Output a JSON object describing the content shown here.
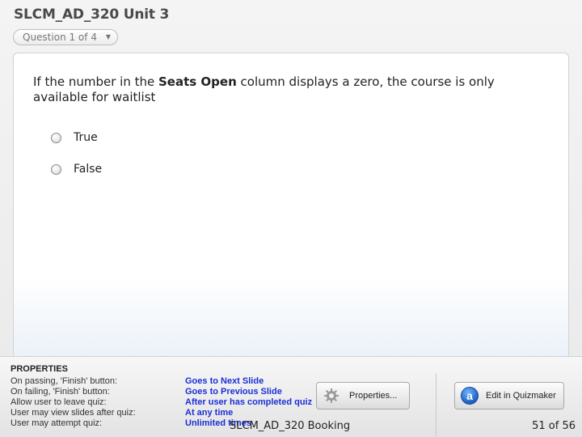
{
  "header": {
    "title": "SLCM_AD_320 Unit 3",
    "question_selector": "Question 1 of 4"
  },
  "question": {
    "text_before": "If the number in the ",
    "text_bold": "Seats Open",
    "text_after": " column displays a zero, the course is only available for waitlist",
    "choices": [
      {
        "label": "True",
        "selected": false
      },
      {
        "label": "False",
        "selected": false
      }
    ]
  },
  "properties": {
    "heading": "PROPERTIES",
    "rows": [
      {
        "label": "On passing, 'Finish' button:",
        "value": "Goes to Next Slide"
      },
      {
        "label": "On failing, 'Finish' button:",
        "value": "Goes to Previous Slide"
      },
      {
        "label": "Allow user to leave quiz:",
        "value": "After user has completed quiz"
      },
      {
        "label": "User may view slides after quiz:",
        "value": "At any time"
      },
      {
        "label": "User may attempt quiz:",
        "value": "Unlimited times"
      }
    ],
    "properties_button": "Properties...",
    "edit_button": "Edit in Quizmaker",
    "edit_icon_glyph": "a"
  },
  "status": {
    "slide_name": "SLCM_AD_320 Booking",
    "slide_count": "51 of 56"
  },
  "colors": {
    "value_text": "#1a2fd6",
    "title_text": "#4a4a4a"
  },
  "icons": {
    "selector_caret": "chevron-down-icon",
    "properties_button": "gear-icon",
    "edit_button": "quizmaker-logo-icon"
  }
}
